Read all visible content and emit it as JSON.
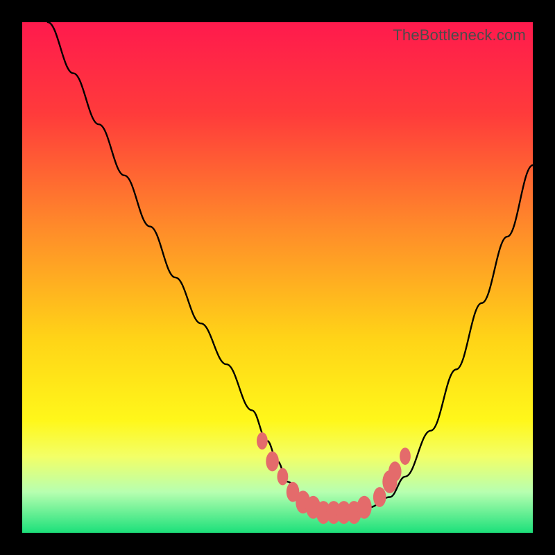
{
  "watermark": "TheBottleneck.com",
  "colors": {
    "frame": "#000000",
    "curve": "#000000",
    "marker": "#e46b6b",
    "gradient_stops": [
      {
        "pct": 0,
        "color": "#ff1a4d"
      },
      {
        "pct": 18,
        "color": "#ff3b3b"
      },
      {
        "pct": 40,
        "color": "#ff8a2a"
      },
      {
        "pct": 62,
        "color": "#ffd417"
      },
      {
        "pct": 78,
        "color": "#fff71a"
      },
      {
        "pct": 85,
        "color": "#f3ff66"
      },
      {
        "pct": 92,
        "color": "#b7ffb0"
      },
      {
        "pct": 100,
        "color": "#1ce07a"
      }
    ]
  },
  "chart_data": {
    "type": "line",
    "title": "",
    "xlabel": "",
    "ylabel": "",
    "xlim": [
      0,
      100
    ],
    "ylim": [
      0,
      100
    ],
    "grid": false,
    "legend": false,
    "series": [
      {
        "name": "bottleneck-curve",
        "x": [
          5,
          10,
          15,
          20,
          25,
          30,
          35,
          40,
          45,
          48,
          50,
          52,
          55,
          58,
          60,
          62,
          65,
          68,
          72,
          75,
          80,
          85,
          90,
          95,
          100
        ],
        "y": [
          100,
          90,
          80,
          70,
          60,
          50,
          41,
          33,
          24,
          18,
          14,
          10,
          7,
          5,
          4,
          4,
          4,
          5,
          7,
          11,
          20,
          32,
          45,
          58,
          72
        ]
      }
    ],
    "markers": [
      {
        "x": 47,
        "y": 18,
        "r": 1.2
      },
      {
        "x": 49,
        "y": 14,
        "r": 1.4
      },
      {
        "x": 51,
        "y": 11,
        "r": 1.2
      },
      {
        "x": 53,
        "y": 8,
        "r": 1.4
      },
      {
        "x": 55,
        "y": 6,
        "r": 1.6
      },
      {
        "x": 57,
        "y": 5,
        "r": 1.6
      },
      {
        "x": 59,
        "y": 4,
        "r": 1.6
      },
      {
        "x": 61,
        "y": 4,
        "r": 1.6
      },
      {
        "x": 63,
        "y": 4,
        "r": 1.6
      },
      {
        "x": 65,
        "y": 4,
        "r": 1.6
      },
      {
        "x": 67,
        "y": 5,
        "r": 1.6
      },
      {
        "x": 70,
        "y": 7,
        "r": 1.4
      },
      {
        "x": 72,
        "y": 10,
        "r": 1.6
      },
      {
        "x": 73,
        "y": 12,
        "r": 1.4
      },
      {
        "x": 75,
        "y": 15,
        "r": 1.2
      }
    ]
  }
}
